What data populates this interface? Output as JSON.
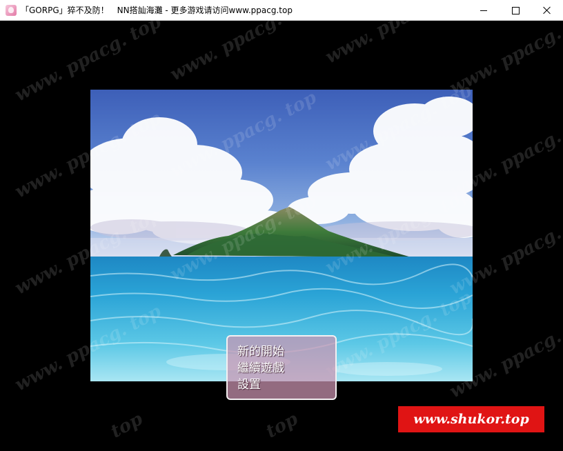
{
  "window": {
    "title": "「GORPG」猝不及防！　NN搭訕海灘 - 更多游戏请访问www.ppacg.top",
    "icon": "app-icon"
  },
  "watermark": {
    "text": "www. ppacg. top",
    "short_text": "top",
    "badge": "www.shukor.top",
    "badge_color": "#e01414"
  },
  "menu": {
    "items": [
      {
        "label": "新的開始"
      },
      {
        "label": "繼續遊戲"
      },
      {
        "label": "設置"
      }
    ]
  },
  "colors": {
    "menu_bg": "#cc94b2",
    "menu_border": "#f4f0f2",
    "sky": "#3d5fb8",
    "sea": "#2fa6d8"
  }
}
